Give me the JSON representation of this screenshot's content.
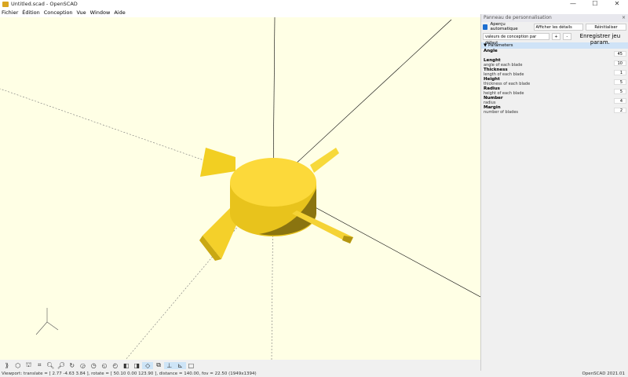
{
  "window": {
    "title": "Untitled.scad - OpenSCAD",
    "controls": [
      "—",
      "☐",
      "✕"
    ]
  },
  "menu": [
    "Fichier",
    "Édition",
    "Conception",
    "Vue",
    "Window",
    "Aide"
  ],
  "panel": {
    "title": "Panneau de personnalisation",
    "close": "×",
    "auto_preview": "Aperçu automatique",
    "details_select": "Afficher les détails",
    "reset": "Réinitialiser",
    "preset_select": "valeurs de conception par défaut",
    "plus": "+",
    "minus": "-",
    "save_preset": "Enregistrer jeu param.",
    "section": "Parameters",
    "params": [
      {
        "name": "Angle",
        "desc": "",
        "value": "45"
      },
      {
        "name": "Lenght",
        "desc": "angle of each blade",
        "value": "10"
      },
      {
        "name": "Thickness",
        "desc": "length of each blade",
        "value": "1"
      },
      {
        "name": "Height",
        "desc": "thickness of each blade",
        "value": "5"
      },
      {
        "name": "Radius",
        "desc": "height of each blade",
        "value": "5"
      },
      {
        "name": "Number",
        "desc": "radius",
        "value": "4"
      },
      {
        "name": "Margin",
        "desc": "number of blades",
        "value": "2"
      }
    ]
  },
  "toolbar": [
    "preview",
    "render",
    "export-stl",
    "view-all",
    "zoom-in",
    "zoom-out",
    "reset-view",
    "view-right",
    "view-top",
    "view-bottom",
    "view-left",
    "view-front",
    "view-back",
    "perspective",
    "orthogonal",
    "show-axes",
    "show-scale",
    "show-edges"
  ],
  "status": {
    "viewport": "Viewport: translate = [ 2.77 -4.63 3.84 ], rotate = [ 50.10 0.00 123.90 ], distance = 140.00, fov = 22.50 (1949x1394)",
    "version": "OpenSCAD 2021.01"
  },
  "colors": {
    "viewport_bg": "#ffffe5",
    "model": "#f9d52e",
    "accent": "#1e6fd0"
  }
}
